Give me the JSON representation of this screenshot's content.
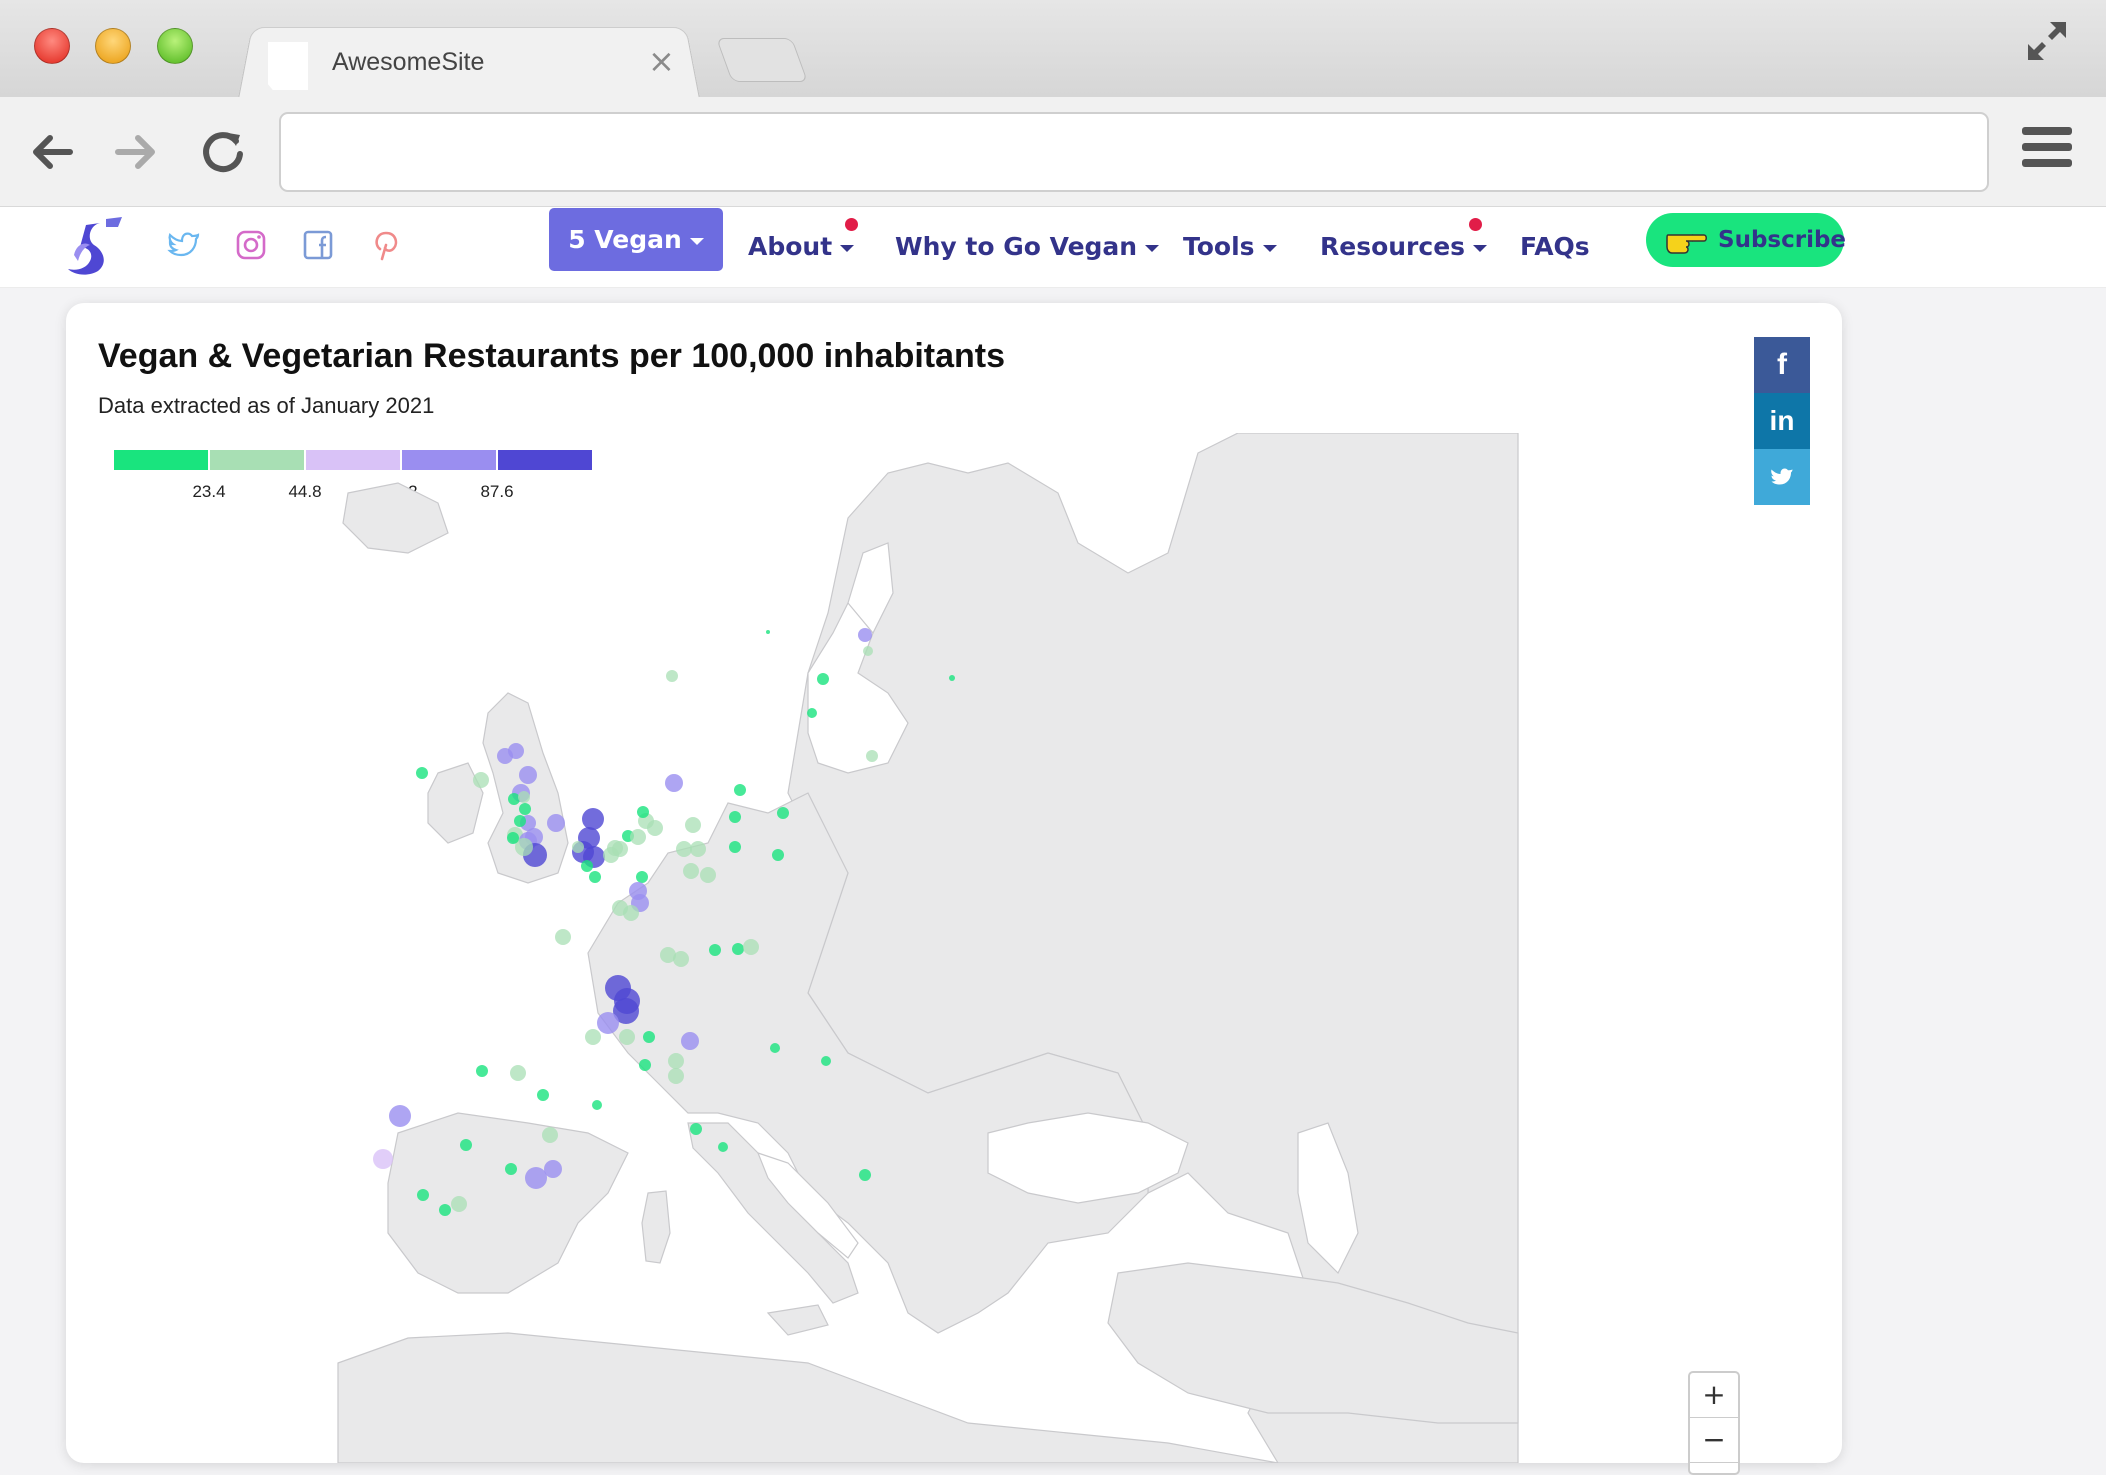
{
  "browser": {
    "tab_title": "AwesomeSite",
    "tab_close": "×",
    "url": ""
  },
  "nav": {
    "logo_icon": "five-vegan-logo-icon",
    "social_icons": [
      "twitter-icon",
      "instagram-icon",
      "facebook-icon",
      "pinterest-icon"
    ],
    "items": [
      {
        "label": "5 Vegan",
        "dropdown": true,
        "active": true
      },
      {
        "label": "About",
        "dropdown": true,
        "notification": true
      },
      {
        "label": "Why to Go Vegan",
        "dropdown": true
      },
      {
        "label": "Tools",
        "dropdown": true
      },
      {
        "label": "Resources",
        "dropdown": true,
        "notification": true
      },
      {
        "label": "FAQs",
        "dropdown": false
      }
    ],
    "subscribe_label": "Subscribe",
    "subscribe_icon": "pointing-hand-icon",
    "colors": {
      "accent": "#6d6ce0",
      "link": "#33338a",
      "subscribe": "#19e47e",
      "notification": "#e11d48"
    }
  },
  "map": {
    "title": "Vegan & Vegetarian Restaurants per 100,000 inhabitants",
    "subtitle": "Data extracted as of January 2021",
    "legend": {
      "thresholds": [
        "23.4",
        "44.8",
        "66.2",
        "87.6"
      ],
      "colors": [
        "#19e47e",
        "#a8dfb4",
        "#d9c2f7",
        "#9a8ef0",
        "#4f47d3"
      ]
    },
    "share": [
      {
        "name": "facebook",
        "label": "f",
        "color": "#3b5998"
      },
      {
        "name": "linkedin",
        "label": "in",
        "color": "#0e76a8"
      },
      {
        "name": "twitter",
        "label": "🐦",
        "color": "#3fa9d9"
      }
    ],
    "zoom_in": "+",
    "zoom_out": "−"
  }
}
